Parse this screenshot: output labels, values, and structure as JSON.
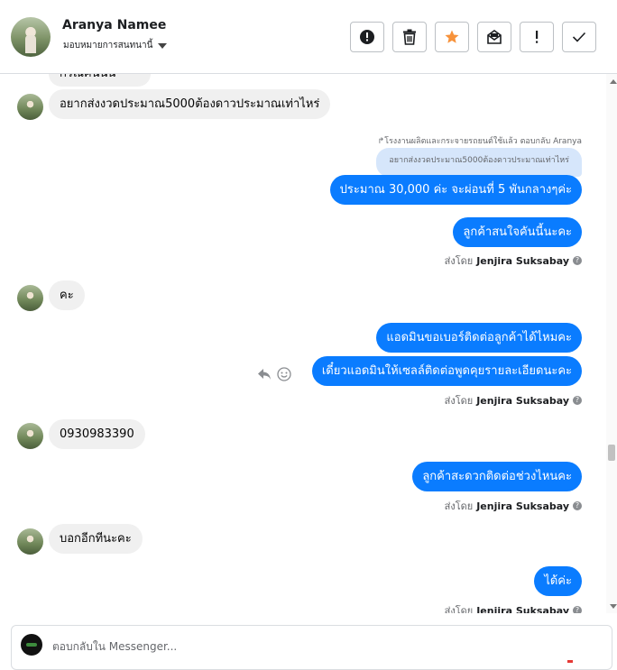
{
  "header": {
    "name": "Aranya Namee",
    "assign_label": "มอบหมายการสนทนานี้",
    "actions": [
      "spam",
      "delete",
      "star",
      "unread",
      "follow-up",
      "done"
    ],
    "accent": "#f7923a"
  },
  "messages": {
    "partial_top": "กรณีคันนั้น",
    "in1": "อยากส่งงวดประมาณ5000ต้องดาวประมาณเท่าไหร่",
    "reply_ctx": "↱โรงงานผลิตและกระจายรถยนต์ใช้แล้ว ตอบกลับ Aranya",
    "quoted": "อยากส่งงวดประมาณ5000ต้องดาวประมาณเท่าไหร่",
    "out1": "ประมาณ 30,000 ค่ะ จะผ่อนที่ 5 พันกลางๆค่ะ",
    "out2": "ลูกค้าสนใจคันนี้นะคะ",
    "in2": "คะ",
    "out3": "แอดมินขอเบอร์ติดต่อลูกค้าได้ไหมคะ",
    "out4": "เดี๋ยวแอดมินให้เซลล์ติดต่อพูดคุยรายละเอียดนะคะ",
    "in3": "0930983390",
    "out5": "ลูกค้าสะดวกติดต่อช่วงไหนคะ",
    "in4": "บอกอีกทีนะคะ",
    "out6": "ได้ค่ะ"
  },
  "sent_by": {
    "prefix": "ส่งโดย",
    "agent": "Jenjira Suksabay"
  },
  "composer": {
    "placeholder": "ตอบกลับใน Messenger..."
  },
  "colors": {
    "outgoing": "#0a7cff",
    "incoming": "#f0f0f0"
  }
}
